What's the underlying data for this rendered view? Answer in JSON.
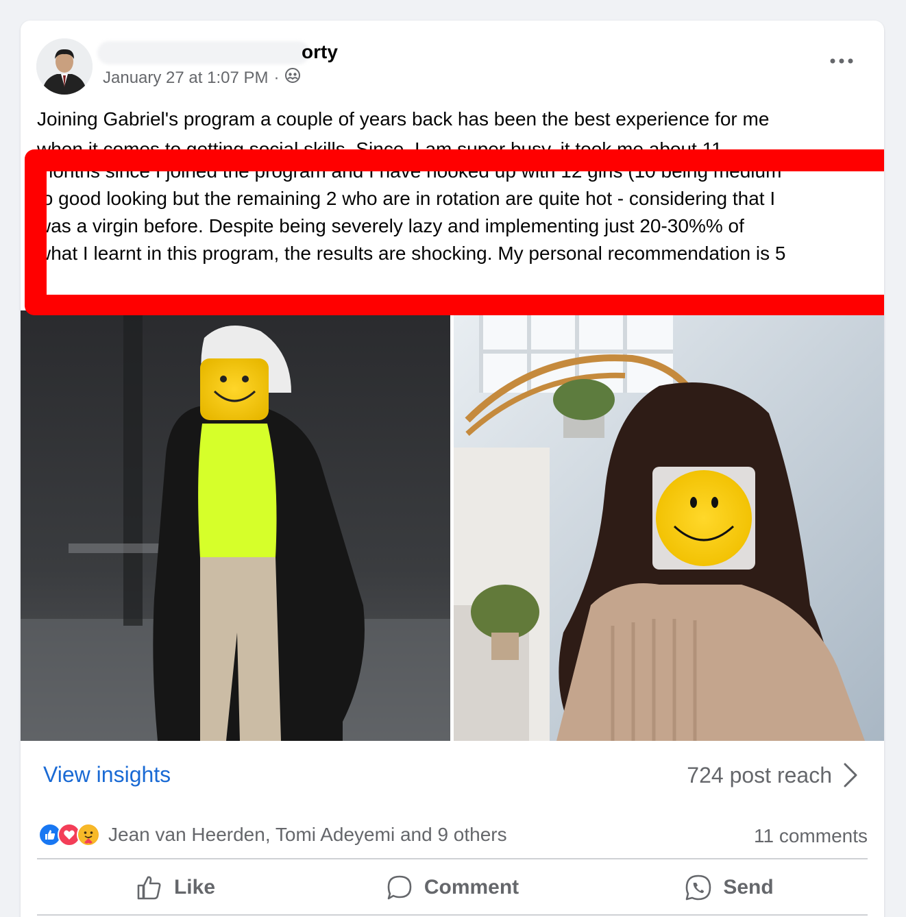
{
  "post": {
    "author_visible": "orty",
    "timestamp": "January 27 at 1:07 PM",
    "separator": "·",
    "audience_icon": "friends-icon",
    "more_label": "•••",
    "text_first_line": "Joining Gabriel's program a couple of years back has been the best experience for me",
    "text_hidden_line": "when it comes to getting social skills. Since, I am super busy, it took me about 11",
    "text_highlighted_lines": [
      "months since I joined the program and I have hooked up with 12 girls (10 being medium",
      "to good looking but the remaining 2 who are in rotation are quite hot - considering that I",
      "was a virgin before. Despite being severely lazy  and implementing just 20-30%% of",
      "what I learnt in this program, the results are shocking. My personal recommendation is 5"
    ],
    "highlight_color": "#ff0000"
  },
  "insights": {
    "view_label": "View insights",
    "reach_label": "724 post reach",
    "link_color": "#1a6ad4"
  },
  "engagement": {
    "reaction_icons": [
      "like-icon",
      "love-icon",
      "care-icon"
    ],
    "reactors": "Jean van Heerden, Tomi Adeyemi and 9 others",
    "comments": "11 comments"
  },
  "actions": {
    "like": "Like",
    "comment": "Comment",
    "send": "Send"
  }
}
